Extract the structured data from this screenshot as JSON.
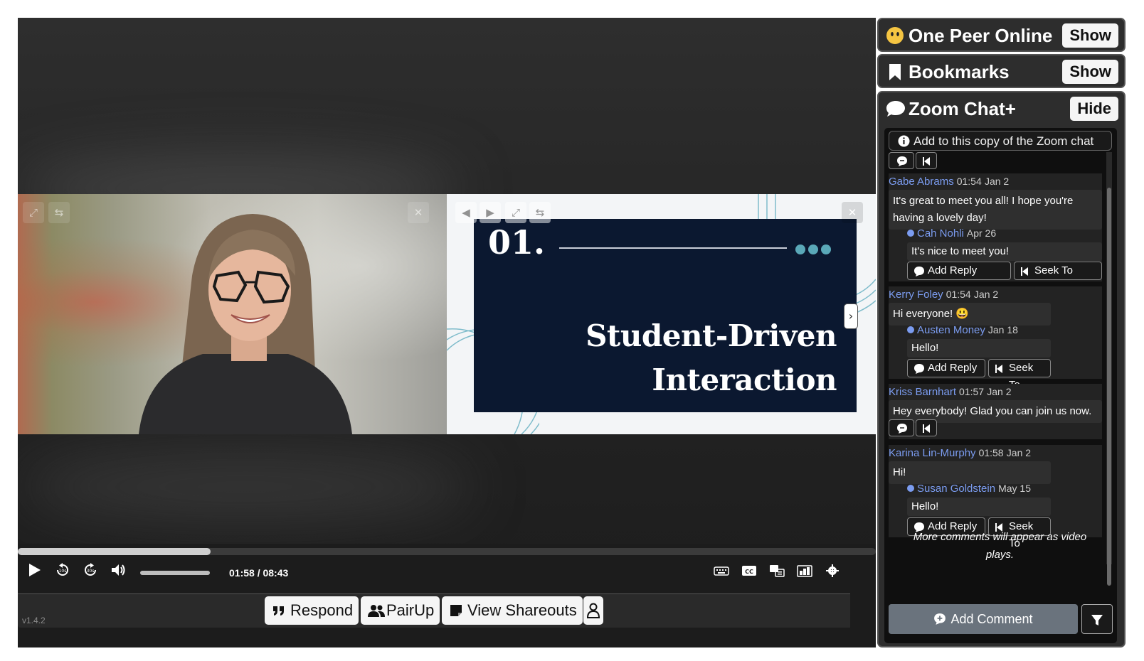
{
  "player": {
    "current_time": "01:58",
    "duration": "08:43",
    "time_display": "01:58 / 08:43",
    "progress_fraction": 0.225,
    "version": "v1.4.2"
  },
  "slide": {
    "number": "01.",
    "title_line1": "Student-Driven",
    "title_line2": "Interaction"
  },
  "toolbar": {
    "respond_label": "Respond",
    "pairup_label": "PairUp",
    "view_shareouts_label": "View Shareouts"
  },
  "panel": {
    "peers": {
      "title": "One Peer Online",
      "button": "Show"
    },
    "bookmarks": {
      "title": "Bookmarks",
      "button": "Show"
    },
    "chat": {
      "title": "Zoom Chat+",
      "button": "Hide"
    }
  },
  "chat": {
    "add_copy_label": "Add to this copy of the Zoom chat",
    "messages": [
      {
        "author": "Gabe Abrams",
        "time": "01:54",
        "date": "Jan 2",
        "text_line1": "It's great to meet you all! I hope you're",
        "text_line2": "having a lovely day!",
        "reply": {
          "author": "Cah Nohli",
          "date": "Apr 26",
          "text": "It's nice to meet you!"
        }
      },
      {
        "author": "Kerry Foley",
        "time": "01:54",
        "date": "Jan 2",
        "text": "Hi everyone! 😃",
        "reply": {
          "author": "Austen Money",
          "date": "Jan 18",
          "text": "Hello!"
        }
      },
      {
        "author": "Kriss Barnhart",
        "time": "01:57",
        "date": "Jan 2",
        "text": "Hey everybody! Glad you can join us now."
      },
      {
        "author": "Karina Lin-Murphy",
        "time": "01:58",
        "date": "Jan 2",
        "text": "Hi!",
        "reply": {
          "author": "Susan Goldstein",
          "date": "May 15",
          "text": "Hello!"
        }
      }
    ],
    "add_reply_label": "Add Reply",
    "seek_to_label": "Seek To",
    "more_note": "More comments will appear as video plays.",
    "add_comment_label": "Add Comment"
  }
}
